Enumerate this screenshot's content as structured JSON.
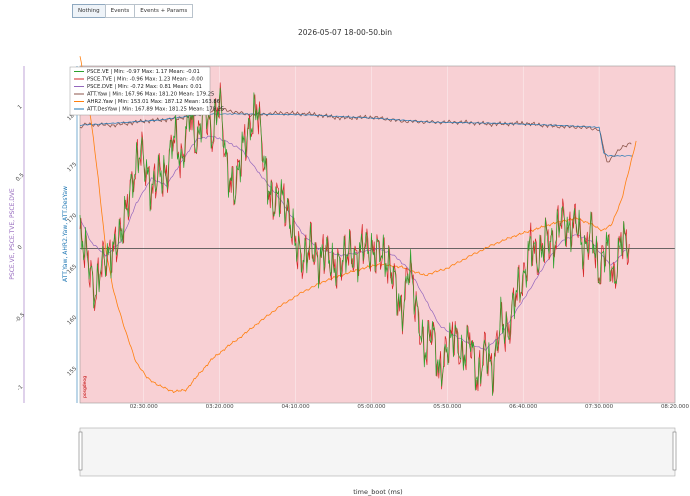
{
  "toolbar": {
    "buttons": [
      "Nothing",
      "Events",
      "Events + Params"
    ],
    "active": "Nothing"
  },
  "chart_data": {
    "type": "line",
    "title": "2026-05-07 18-00-50.bin",
    "xlabel": "time_boot (ms)",
    "y_left_label": "PSCE.VE, PSCE.TVE, PSCE.DVE",
    "y_right_label": "ATT.Yaw, AHR2.Yaw, ATT.DesYaw",
    "x_ticks": [
      "02:30.000",
      "03:20.000",
      "04:10.000",
      "05:00.000",
      "05:50.000",
      "06:40.000",
      "07:30.000",
      "08:20.000"
    ],
    "x_tick_seconds": [
      150,
      200,
      250,
      300,
      350,
      400,
      450,
      500
    ],
    "x_range_seconds": [
      108,
      500
    ],
    "y1_ticks": [
      "1",
      "0.5",
      "0",
      "-0.5",
      "-1"
    ],
    "y1_tick_values": [
      1,
      0.5,
      0,
      -0.5,
      -1
    ],
    "y1_range": [
      -1.1,
      1.3
    ],
    "y2_ticks": [
      "180",
      "175",
      "170",
      "165",
      "160",
      "155"
    ],
    "y2_tick_values": [
      180,
      175,
      170,
      165,
      160,
      155
    ],
    "y2_range": [
      152,
      185
    ],
    "mode_band": {
      "label": "posgdeog",
      "color": "#f8d0d4"
    },
    "zero_line_color": "#555555",
    "series": [
      {
        "name": "PSCE.VE | Min: -0.97    Max: 1.17    Mean: -0.01",
        "color": "#2ca02c",
        "axis": "y1"
      },
      {
        "name": "PSCE.TVE | Min: -0.96    Max: 1.23    Mean: -0.00",
        "color": "#d62728",
        "axis": "y1"
      },
      {
        "name": "PSCE.DVE | Min: -0.72    Max: 0.81    Mean: 0.01",
        "color": "#9467bd",
        "axis": "y1"
      },
      {
        "name": "ATT.Yaw | Min: 167.96    Max: 181.20    Mean: 179.25",
        "color": "#8c564b",
        "axis": "y2"
      },
      {
        "name": "AHR2.Yaw | Min: 153.01    Max: 187.12    Mean: 163.86",
        "color": "#ff7f0e",
        "axis": "y2"
      },
      {
        "name": "ATT.DesYaw | Min: 167.89    Max: 181.25    Mean: 179.25",
        "color": "#1f77b4",
        "axis": "y2"
      }
    ],
    "curves": {
      "ahr2_yaw": [
        [
          108,
          186
        ],
        [
          115,
          180
        ],
        [
          120,
          174
        ],
        [
          125,
          167
        ],
        [
          130,
          163
        ],
        [
          138,
          159
        ],
        [
          145,
          156
        ],
        [
          152,
          154.5
        ],
        [
          160,
          153.7
        ],
        [
          170,
          153.1
        ],
        [
          178,
          153.3
        ],
        [
          185,
          154.6
        ],
        [
          195,
          156.3
        ],
        [
          205,
          157.5
        ],
        [
          215,
          158.6
        ],
        [
          225,
          159.8
        ],
        [
          240,
          161.5
        ],
        [
          255,
          162.9
        ],
        [
          270,
          164.0
        ],
        [
          290,
          165.0
        ],
        [
          305,
          165.6
        ],
        [
          320,
          165.3
        ],
        [
          335,
          164.5
        ],
        [
          350,
          165.2
        ],
        [
          365,
          166.4
        ],
        [
          380,
          167.5
        ],
        [
          395,
          168.4
        ],
        [
          410,
          169.1
        ],
        [
          420,
          169.6
        ],
        [
          435,
          170.1
        ],
        [
          445,
          169.5
        ],
        [
          452,
          168.9
        ],
        [
          458,
          169.4
        ],
        [
          465,
          172
        ],
        [
          470,
          175
        ],
        [
          475,
          178
        ]
      ],
      "att_yaw": [
        [
          108,
          179.0
        ],
        [
          112,
          179.3
        ],
        [
          130,
          179.2
        ],
        [
          150,
          179.6
        ],
        [
          170,
          179.8
        ],
        [
          190,
          180.4
        ],
        [
          200,
          180.8
        ],
        [
          220,
          180.2
        ],
        [
          240,
          180.4
        ],
        [
          260,
          180.3
        ],
        [
          280,
          179.9
        ],
        [
          300,
          180.0
        ],
        [
          320,
          179.6
        ],
        [
          340,
          179.5
        ],
        [
          360,
          179.5
        ],
        [
          380,
          179.3
        ],
        [
          400,
          179.4
        ],
        [
          420,
          179.1
        ],
        [
          440,
          179.0
        ],
        [
          450,
          178.8
        ],
        [
          453,
          177.0
        ],
        [
          455,
          175.5
        ],
        [
          458,
          176.0
        ],
        [
          465,
          177.0
        ],
        [
          472,
          177.6
        ]
      ],
      "des_yaw": [
        [
          108,
          179.2
        ],
        [
          130,
          179.4
        ],
        [
          160,
          179.7
        ],
        [
          190,
          180.3
        ],
        [
          220,
          180.3
        ],
        [
          260,
          180.2
        ],
        [
          300,
          179.9
        ],
        [
          340,
          179.5
        ],
        [
          380,
          179.4
        ],
        [
          420,
          179.2
        ],
        [
          450,
          179.0
        ],
        [
          453,
          176.5
        ],
        [
          456,
          176.2
        ],
        [
          472,
          176.2
        ]
      ],
      "dve_trend": [
        [
          108,
          0.22
        ],
        [
          115,
          0.05
        ],
        [
          125,
          -0.05
        ],
        [
          135,
          0.05
        ],
        [
          145,
          0.32
        ],
        [
          155,
          0.5
        ],
        [
          165,
          0.45
        ],
        [
          175,
          0.62
        ],
        [
          185,
          0.78
        ],
        [
          195,
          0.8
        ],
        [
          205,
          0.76
        ],
        [
          215,
          0.7
        ],
        [
          225,
          0.55
        ],
        [
          240,
          0.35
        ],
        [
          255,
          0.1
        ],
        [
          265,
          0.0
        ],
        [
          280,
          -0.05
        ],
        [
          295,
          -0.02
        ],
        [
          305,
          0.0
        ],
        [
          315,
          -0.05
        ],
        [
          325,
          -0.15
        ],
        [
          335,
          -0.35
        ],
        [
          345,
          -0.55
        ],
        [
          355,
          -0.62
        ],
        [
          365,
          -0.68
        ],
        [
          375,
          -0.72
        ],
        [
          385,
          -0.62
        ],
        [
          395,
          -0.45
        ],
        [
          405,
          -0.28
        ],
        [
          415,
          -0.1
        ],
        [
          425,
          0.05
        ],
        [
          435,
          0.1
        ],
        [
          445,
          0.05
        ],
        [
          452,
          -0.05
        ],
        [
          458,
          -0.12
        ],
        [
          462,
          -0.08
        ],
        [
          468,
          0.0
        ]
      ],
      "ve_trend": [
        [
          108,
          0.1
        ],
        [
          113,
          -0.05
        ],
        [
          118,
          -0.35
        ],
        [
          122,
          -0.1
        ],
        [
          128,
          -0.05
        ],
        [
          135,
          0.1
        ],
        [
          142,
          0.45
        ],
        [
          148,
          0.72
        ],
        [
          155,
          0.4
        ],
        [
          160,
          0.55
        ],
        [
          165,
          0.5
        ],
        [
          170,
          0.85
        ],
        [
          175,
          0.58
        ],
        [
          180,
          1.0
        ],
        [
          185,
          0.72
        ],
        [
          190,
          1.05
        ],
        [
          195,
          0.78
        ],
        [
          200,
          1.08
        ],
        [
          205,
          0.55
        ],
        [
          210,
          0.4
        ],
        [
          215,
          0.72
        ],
        [
          220,
          0.85
        ],
        [
          225,
          1.02
        ],
        [
          230,
          0.55
        ],
        [
          235,
          0.3
        ],
        [
          240,
          0.4
        ],
        [
          245,
          0.25
        ],
        [
          250,
          0.05
        ],
        [
          255,
          -0.1
        ],
        [
          260,
          0.05
        ],
        [
          265,
          -0.12
        ],
        [
          270,
          0.0
        ],
        [
          275,
          -0.15
        ],
        [
          280,
          -0.1
        ],
        [
          285,
          0.0
        ],
        [
          290,
          -0.1
        ],
        [
          295,
          0.05
        ],
        [
          300,
          -0.05
        ],
        [
          305,
          0.0
        ],
        [
          310,
          -0.1
        ],
        [
          315,
          -0.2
        ],
        [
          320,
          -0.5
        ],
        [
          325,
          -0.1
        ],
        [
          330,
          -0.45
        ],
        [
          335,
          -0.75
        ],
        [
          340,
          -0.55
        ],
        [
          345,
          -0.92
        ],
        [
          350,
          -0.7
        ],
        [
          355,
          -0.6
        ],
        [
          360,
          -0.8
        ],
        [
          365,
          -0.62
        ],
        [
          370,
          -0.96
        ],
        [
          375,
          -0.7
        ],
        [
          380,
          -0.9
        ],
        [
          385,
          -0.5
        ],
        [
          390,
          -0.62
        ],
        [
          395,
          -0.3
        ],
        [
          400,
          -0.25
        ],
        [
          405,
          0.05
        ],
        [
          410,
          -0.1
        ],
        [
          415,
          0.1
        ],
        [
          420,
          0.0
        ],
        [
          425,
          0.25
        ],
        [
          430,
          0.1
        ],
        [
          435,
          0.22
        ],
        [
          440,
          -0.05
        ],
        [
          445,
          0.15
        ],
        [
          450,
          -0.2
        ],
        [
          455,
          0.05
        ],
        [
          460,
          -0.25
        ],
        [
          465,
          0.1
        ],
        [
          470,
          0.0
        ]
      ]
    }
  }
}
